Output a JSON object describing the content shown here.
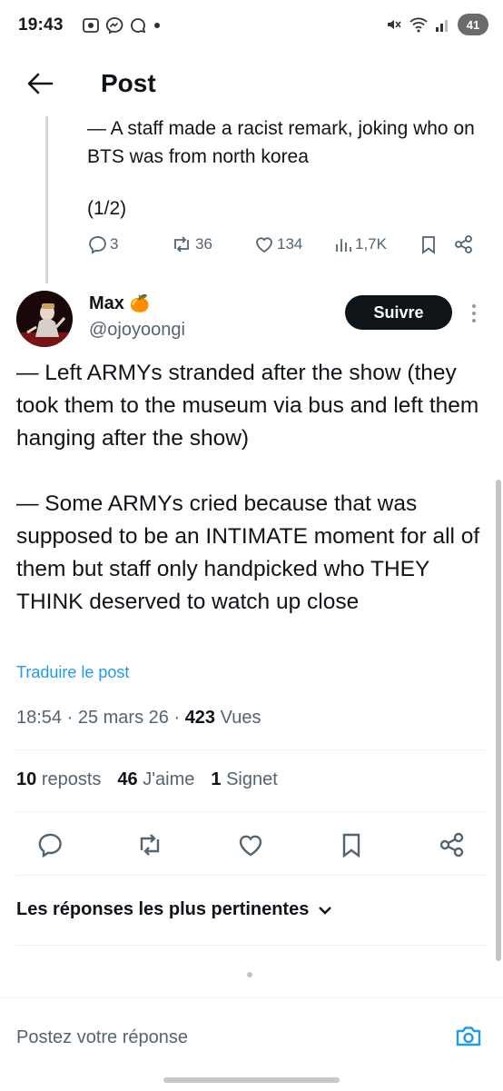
{
  "status_bar": {
    "time": "19:43",
    "left_icons": [
      "screen-record-icon",
      "messenger-icon",
      "chat-icon",
      "dot-icon"
    ],
    "right_icons": [
      "mute-icon",
      "wifi-icon",
      "signal-icon"
    ],
    "battery": "41"
  },
  "header": {
    "title": "Post"
  },
  "previous_post": {
    "text": "— A staff made a racist remark, joking who on BTS was from north korea",
    "page_indicator": "(1/2)",
    "actions": {
      "replies": "3",
      "reposts": "36",
      "likes": "134",
      "views": "1,7K"
    }
  },
  "post": {
    "author_name": "Max",
    "author_emoji": "🍊",
    "handle": "@ojoyoongi",
    "follow_label": "Suivre",
    "paragraphs": [
      "— Left ARMYs stranded after the show (they took them to the museum via bus and left them hanging after the show)",
      "— Some ARMYs cried because that was supposed to be an INTIMATE moment for all of them but staff only handpicked who THEY THINK deserved to watch up close"
    ],
    "translate_label": "Traduire le post",
    "time": "18:54",
    "date": "25 mars 26",
    "views_count": "423",
    "views_label": "Vues",
    "reposts_count": "10",
    "reposts_label": "reposts",
    "likes_count": "46",
    "likes_label": "J'aime",
    "bookmarks_count": "1",
    "bookmarks_label": "Signet"
  },
  "replies_filter": {
    "label": "Les réponses les plus pertinentes"
  },
  "reply_bar": {
    "placeholder": "Postez votre réponse"
  },
  "colors": {
    "accent": "#1d9bf0",
    "text": "#0f1419",
    "secondary": "#536471",
    "button_dark": "#0f1419"
  }
}
